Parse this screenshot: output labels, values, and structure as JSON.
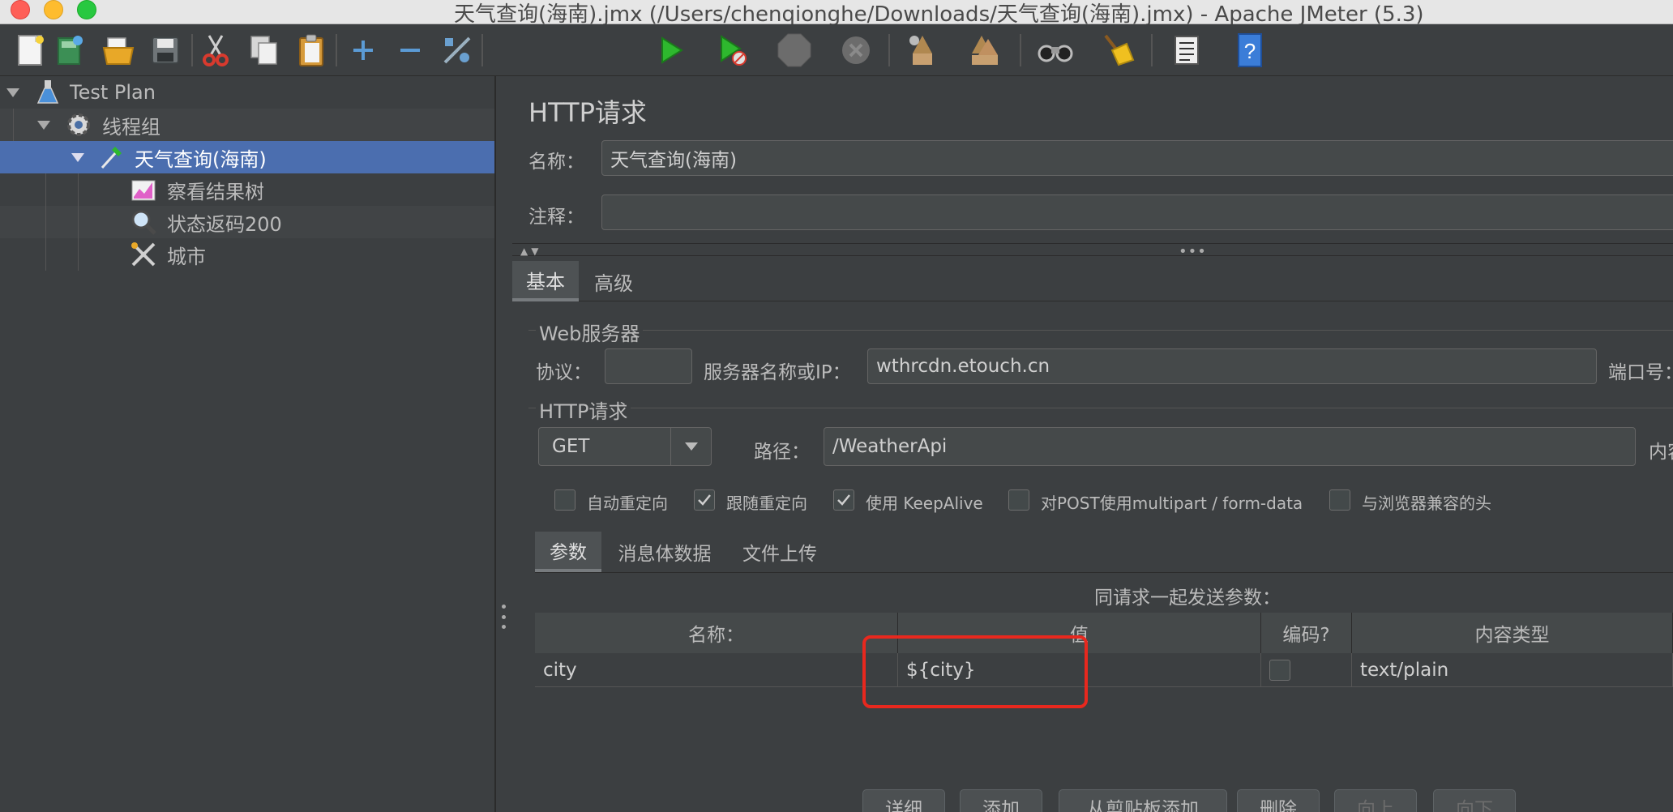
{
  "window": {
    "title": "天气查询(海南).jmx (/Users/chenqionghe/Downloads/天气查询(海南).jmx) - Apache JMeter (5.3)"
  },
  "toolbar": {
    "buttons": [
      {
        "icon": "new-document-icon",
        "color": "#f0f0f0"
      },
      {
        "icon": "templates-icon",
        "color": "#4aa860"
      },
      {
        "icon": "open-folder-icon",
        "color": "#e8b13a"
      },
      {
        "icon": "save-icon",
        "color": "#9aa0a4"
      },
      {
        "icon": "cut-icon",
        "color": "#d83a2e"
      },
      {
        "icon": "copy-icon",
        "color": "#d0d0d0"
      },
      {
        "icon": "paste-icon",
        "color": "#e0b060"
      },
      {
        "icon": "expand-icon",
        "color": "#5b9bd5"
      },
      {
        "icon": "collapse-icon",
        "color": "#5b9bd5"
      },
      {
        "icon": "toggle-icon",
        "color": "#6aa0d0"
      },
      {
        "icon": "start-icon",
        "color": "#2eb82e"
      },
      {
        "icon": "start-no-pauses-icon",
        "color": "#2eb82e"
      },
      {
        "icon": "stop-icon",
        "color": "#777777"
      },
      {
        "icon": "shutdown-icon",
        "color": "#777777"
      },
      {
        "icon": "clear-icon",
        "color": "#b08850"
      },
      {
        "icon": "clear-all-icon",
        "color": "#b08850"
      },
      {
        "icon": "search-icon",
        "color": "#cccccc"
      },
      {
        "icon": "reset-search-icon",
        "color": "#f0c020"
      },
      {
        "icon": "function-helper-icon",
        "color": "#dddddd"
      },
      {
        "icon": "help-icon",
        "color": "#3b7dd8"
      }
    ]
  },
  "tree": {
    "items": [
      {
        "label": "Test Plan",
        "icon": "flask-icon"
      },
      {
        "label": "线程组",
        "icon": "gear-icon"
      },
      {
        "label": "天气查询(海南)",
        "icon": "sampler-pipette-icon"
      },
      {
        "label": "察看结果树",
        "icon": "graph-icon"
      },
      {
        "label": "状态返码200",
        "icon": "magnifier-icon"
      },
      {
        "label": "城市",
        "icon": "tools-icon"
      }
    ]
  },
  "panel": {
    "title": "HTTP请求",
    "name_label": "名称：",
    "name_value": "天气查询(海南)",
    "comment_label": "注释：",
    "comment_value": "",
    "tabs": [
      "基本",
      "高级"
    ],
    "web_server": {
      "group_title": "Web服务器",
      "protocol_label": "协议：",
      "protocol_value": "",
      "server_label": "服务器名称或IP：",
      "server_value": "wthrcdn.etouch.cn",
      "port_label": "端口号："
    },
    "http_request": {
      "group_title": "HTTP请求",
      "method": "GET",
      "path_label": "路径：",
      "path_value": "/WeatherApi",
      "encoding_label": "内容"
    },
    "checkboxes": [
      {
        "label": "自动重定向",
        "checked": false
      },
      {
        "label": "跟随重定向",
        "checked": true
      },
      {
        "label": "使用 KeepAlive",
        "checked": true
      },
      {
        "label": "对POST使用multipart / form-data",
        "checked": false
      },
      {
        "label": "与浏览器兼容的头",
        "checked": false
      }
    ],
    "sub_tabs": [
      "参数",
      "消息体数据",
      "文件上传"
    ],
    "params_caption": "同请求一起发送参数：",
    "table": {
      "headers": [
        "名称：",
        "值",
        "编码?",
        "内容类型"
      ],
      "rows": [
        {
          "name": "city",
          "value": "${city}",
          "encode": false,
          "content_type": "text/plain"
        }
      ]
    },
    "buttons": [
      {
        "label": "详细",
        "enabled": true
      },
      {
        "label": "添加",
        "enabled": true
      },
      {
        "label": "从剪贴板添加",
        "enabled": true
      },
      {
        "label": "删除",
        "enabled": true
      },
      {
        "label": "向上",
        "enabled": false
      },
      {
        "label": "向下",
        "enabled": false
      }
    ]
  }
}
